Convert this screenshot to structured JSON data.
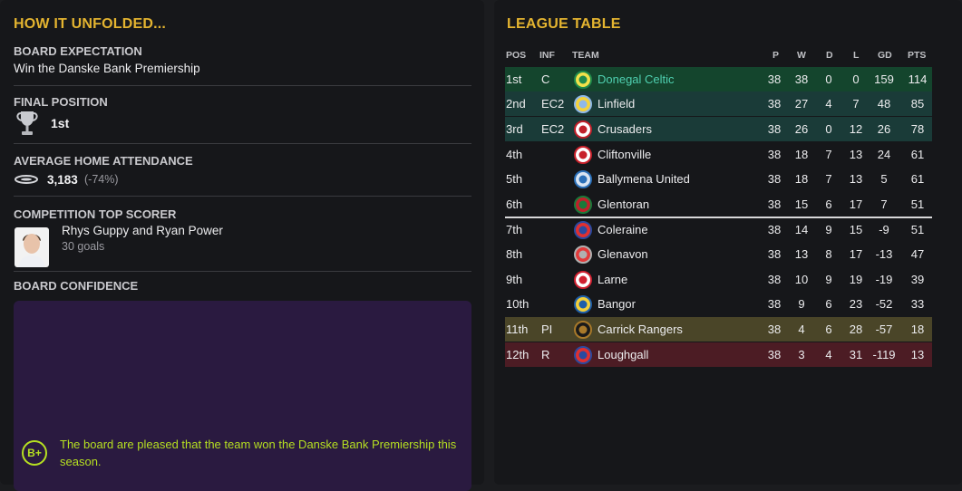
{
  "left_panel": {
    "title": "HOW IT UNFOLDED...",
    "board_expectation": {
      "label": "BOARD EXPECTATION",
      "value": "Win the Danske Bank Premiership"
    },
    "final_position": {
      "label": "FINAL POSITION",
      "value": "1st"
    },
    "attendance": {
      "label": "AVERAGE HOME ATTENDANCE",
      "value": "3,183",
      "change": "(-74%)"
    },
    "top_scorer": {
      "label": "COMPETITION TOP SCORER",
      "name": "Rhys Guppy and Ryan Power",
      "goals": "30 goals"
    },
    "board_confidence": {
      "label": "BOARD CONFIDENCE",
      "grade": "B+",
      "text": "The board are pleased that the team won the Danske Bank Premiership this season."
    }
  },
  "league_table": {
    "title": "LEAGUE TABLE",
    "headers": {
      "pos": "POS",
      "inf": "INF",
      "team": "TEAM",
      "p": "P",
      "w": "W",
      "d": "D",
      "l": "L",
      "gd": "GD",
      "pts": "PTS"
    },
    "rows": [
      {
        "pos": "1st",
        "inf": "C",
        "team": "Donegal Celtic",
        "p": "38",
        "w": "38",
        "d": "0",
        "l": "0",
        "gd": "159",
        "pts": "114",
        "badge": "donegal-celtic-badge"
      },
      {
        "pos": "2nd",
        "inf": "EC2",
        "team": "Linfield",
        "p": "38",
        "w": "27",
        "d": "4",
        "l": "7",
        "gd": "48",
        "pts": "85",
        "badge": "linfield-badge"
      },
      {
        "pos": "3rd",
        "inf": "EC2",
        "team": "Crusaders",
        "p": "38",
        "w": "26",
        "d": "0",
        "l": "12",
        "gd": "26",
        "pts": "78",
        "badge": "crusaders-badge"
      },
      {
        "pos": "4th",
        "inf": "",
        "team": "Cliftonville",
        "p": "38",
        "w": "18",
        "d": "7",
        "l": "13",
        "gd": "24",
        "pts": "61",
        "badge": "cliftonville-badge"
      },
      {
        "pos": "5th",
        "inf": "",
        "team": "Ballymena United",
        "p": "38",
        "w": "18",
        "d": "7",
        "l": "13",
        "gd": "5",
        "pts": "61",
        "badge": "ballymena-united-badge"
      },
      {
        "pos": "6th",
        "inf": "",
        "team": "Glentoran",
        "p": "38",
        "w": "15",
        "d": "6",
        "l": "17",
        "gd": "7",
        "pts": "51",
        "badge": "glentoran-badge"
      },
      {
        "pos": "7th",
        "inf": "",
        "team": "Coleraine",
        "p": "38",
        "w": "14",
        "d": "9",
        "l": "15",
        "gd": "-9",
        "pts": "51",
        "badge": "coleraine-badge"
      },
      {
        "pos": "8th",
        "inf": "",
        "team": "Glenavon",
        "p": "38",
        "w": "13",
        "d": "8",
        "l": "17",
        "gd": "-13",
        "pts": "47",
        "badge": "glenavon-badge"
      },
      {
        "pos": "9th",
        "inf": "",
        "team": "Larne",
        "p": "38",
        "w": "10",
        "d": "9",
        "l": "19",
        "gd": "-19",
        "pts": "39",
        "badge": "larne-badge"
      },
      {
        "pos": "10th",
        "inf": "",
        "team": "Bangor",
        "p": "38",
        "w": "9",
        "d": "6",
        "l": "23",
        "gd": "-52",
        "pts": "33",
        "badge": "bangor-badge"
      },
      {
        "pos": "11th",
        "inf": "PI",
        "team": "Carrick Rangers",
        "p": "38",
        "w": "4",
        "d": "6",
        "l": "28",
        "gd": "-57",
        "pts": "18",
        "badge": "carrick-rangers-badge"
      },
      {
        "pos": "12th",
        "inf": "R",
        "team": "Loughgall",
        "p": "38",
        "w": "3",
        "d": "4",
        "l": "31",
        "gd": "-119",
        "pts": "13",
        "badge": "loughgall-badge"
      }
    ]
  },
  "colors": {
    "title_gold": "#e4b430",
    "champion_row": "#14452d",
    "europe_row": "#1a3b38",
    "playoff_row": "#4a4528",
    "relegation_row": "#4c1c24",
    "champion_team_text": "#4fd0b0",
    "confidence_bg": "#2a1a40",
    "confidence_text": "#b6e021"
  }
}
